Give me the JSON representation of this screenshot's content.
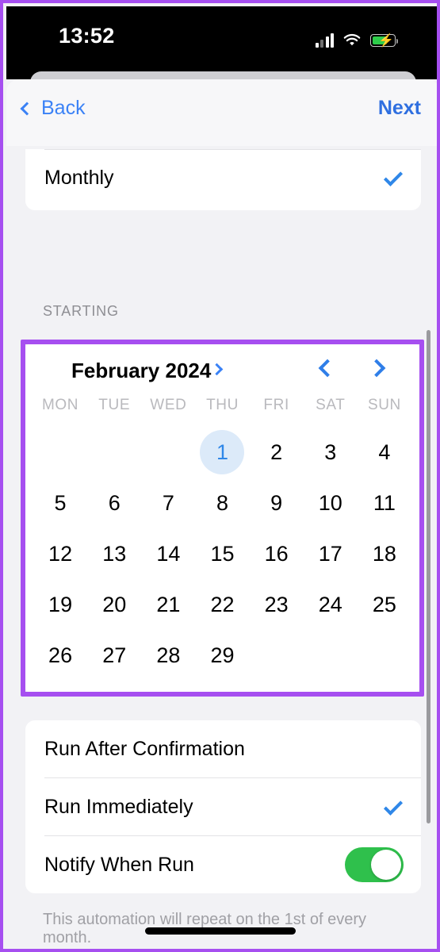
{
  "status_bar": {
    "time": "13:52",
    "cellular_icon": "cellular-signal-icon",
    "wifi_icon": "wifi-icon",
    "battery_icon": "battery-charging-icon"
  },
  "navbar": {
    "back_label": "Back",
    "next_label": "Next",
    "back_icon": "chevron-left-icon"
  },
  "frequency": {
    "selected_row_label": "Monthly",
    "check_icon": "checkmark-icon"
  },
  "starting": {
    "section_header": "STARTING"
  },
  "calendar": {
    "month_label": "February 2024",
    "month_expand_icon": "chevron-right-icon",
    "prev_icon": "chevron-left-icon",
    "next_icon": "chevron-right-icon",
    "weekdays": [
      "MON",
      "TUE",
      "WED",
      "THU",
      "FRI",
      "SAT",
      "SUN"
    ],
    "leading_blanks": 3,
    "days": [
      1,
      2,
      3,
      4,
      5,
      6,
      7,
      8,
      9,
      10,
      11,
      12,
      13,
      14,
      15,
      16,
      17,
      18,
      19,
      20,
      21,
      22,
      23,
      24,
      25,
      26,
      27,
      28,
      29
    ],
    "selected_day": 1,
    "selected_bg_color": "#dceaf9",
    "selected_text_color": "#2f87e8"
  },
  "run_options": {
    "rows": [
      {
        "label": "Run After Confirmation",
        "accessory": "none"
      },
      {
        "label": "Run Immediately",
        "accessory": "checkmark"
      },
      {
        "label": "Notify When Run",
        "accessory": "toggle-on"
      }
    ]
  },
  "footnote": {
    "text": "This automation will repeat on the 1st of every month."
  },
  "colors": {
    "accent_blue": "#3b82f6",
    "toggle_green": "#2fc04c",
    "highlight_purple": "#a64ff0",
    "background_gray": "#f2f2f5"
  }
}
